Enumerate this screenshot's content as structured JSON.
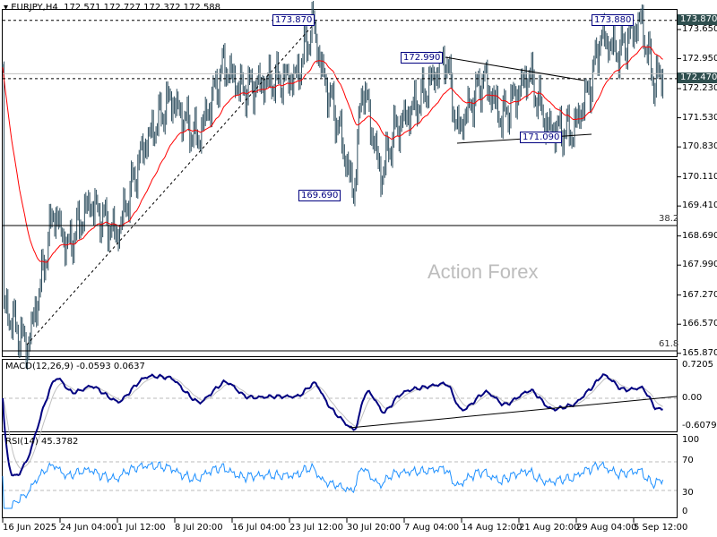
{
  "header": {
    "symbol": "EURJPY,H4",
    "ohlc": "172.571 172.727 172.372 172.588"
  },
  "watermark": "Action Forex",
  "price_axis": [
    "173.650",
    "172.950",
    "172.230",
    "171.530",
    "170.830",
    "170.110",
    "169.410",
    "168.690",
    "167.990",
    "167.270",
    "166.570",
    "165.870"
  ],
  "price_boxes": {
    "high": "173.870",
    "level": "172.470"
  },
  "annotations": {
    "a1": "173.870",
    "a2": "169.690",
    "a3": "172.990",
    "a4": "171.090",
    "a5": "173.880"
  },
  "fib": {
    "f382": "38.2",
    "f618": "61.8"
  },
  "macd": {
    "label": "MACD(12,26,9) -0.0593 0.0637",
    "axis": [
      "0.7205",
      "0.00",
      "-0.6079"
    ]
  },
  "rsi": {
    "label": "RSI(14) 45.3782",
    "axis": [
      "100",
      "70",
      "30",
      "0"
    ]
  },
  "time_axis": [
    "16 Jun 2025",
    "24 Jun 04:00",
    "1 Jul 12:00",
    "8 Jul 20:00",
    "16 Jul 04:00",
    "23 Jul 12:00",
    "30 Jul 20:00",
    "7 Aug 04:00",
    "14 Aug 12:00",
    "21 Aug 20:00",
    "29 Aug 04:00",
    "5 Sep 12:00"
  ],
  "chart_data": {
    "type": "line",
    "title": "EURJPY,H4",
    "ylim": [
      165.87,
      173.87
    ],
    "key_levels": [
      173.87,
      172.47,
      172.588
    ],
    "fib_levels": {
      "38.2": 168.9,
      "61.8": 165.9
    },
    "price_path_bar_price": [
      [
        1,
        167.0
      ],
      [
        19,
        166.0
      ],
      [
        29,
        167.5
      ],
      [
        39,
        169.3
      ],
      [
        50,
        168.4
      ],
      [
        67,
        169.5
      ],
      [
        88,
        168.7
      ],
      [
        108,
        170.8
      ],
      [
        129,
        172.0
      ],
      [
        150,
        171.0
      ],
      [
        170,
        172.8
      ],
      [
        184,
        172.2
      ],
      [
        205,
        172.4
      ],
      [
        226,
        172.5
      ],
      [
        239,
        173.8
      ],
      [
        246,
        172.6
      ],
      [
        257,
        171.5
      ],
      [
        270,
        169.7
      ],
      [
        277,
        172.4
      ],
      [
        291,
        170.1
      ],
      [
        301,
        171.2
      ],
      [
        322,
        172.0
      ],
      [
        341,
        172.99
      ],
      [
        350,
        171.2
      ],
      [
        370,
        172.5
      ],
      [
        384,
        171.5
      ],
      [
        405,
        172.6
      ],
      [
        419,
        171.3
      ],
      [
        439,
        171.2
      ],
      [
        453,
        172.4
      ],
      [
        460,
        173.5
      ],
      [
        474,
        173.1
      ],
      [
        491,
        173.88
      ],
      [
        501,
        172.4
      ],
      [
        508,
        172.59
      ]
    ],
    "series": [
      {
        "name": "Price OHLC"
      },
      {
        "name": "MA",
        "color": "#ff0000"
      },
      {
        "name": "MACD",
        "color": "#000080"
      },
      {
        "name": "Signal",
        "color": "#c0c0c0"
      },
      {
        "name": "RSI(14)",
        "color": "#1e90ff"
      }
    ],
    "macd_ylim": [
      -0.6079,
      0.7205
    ],
    "rsi_ylim": [
      0,
      100
    ],
    "rsi_levels": [
      30,
      70
    ]
  }
}
